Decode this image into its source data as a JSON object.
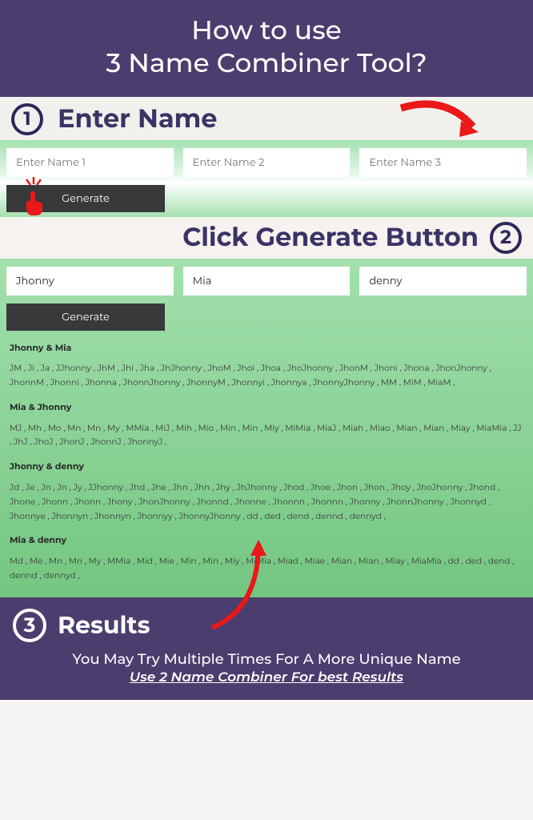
{
  "header": {
    "line1": "How to use",
    "line2": "3 Name Combiner Tool?"
  },
  "step1": {
    "num": "1",
    "label": "Enter Name"
  },
  "inputs_empty": {
    "placeholder1": "Enter Name 1",
    "placeholder2": "Enter Name 2",
    "placeholder3": "Enter Name 3"
  },
  "generate_label": "Generate",
  "step2": {
    "num": "2",
    "label": "Click Generate Button"
  },
  "inputs_filled": {
    "name1": "Jhonny",
    "name2": "Mia",
    "name3": "denny"
  },
  "results": {
    "block1": {
      "title": "Jhonny & Mia",
      "text": "JM , Ji , Ja , JJhonny , JhM , Jhi , Jha , JhJhonny , JhoM , Jhoi , Jhoa , JhoJhonny , JhonM , Jhoni , Jhona , JhonJhonny , JhonnM , Jhonni , Jhonna , JhonnJhonny , JhonnyM , Jhonnyi , Jhonnya , JhonnyJhonny , MM , MiM , MiaM ,"
    },
    "block2": {
      "title": "Mia & Jhonny",
      "text": "MJ , Mh , Mo , Mn , Mn , My , MMia , MiJ , Mih , Mio , Min , Min , Miy , MiMia , MiaJ , Miah , Miao , Mian , Mian , Miay , MiaMia , JJ , JhJ , JhoJ , JhonJ , JhonnJ , JhonnyJ ,"
    },
    "block3": {
      "title": "Jhonny & denny",
      "text": "Jd , Je , Jn , Jn , Jy , JJhonny , Jhd , Jhe , Jhn , Jhn , Jhy , JhJhonny , Jhod , Jhoe , Jhon , Jhon , Jhoy , JhoJhonny , Jhond , Jhone , Jhonn , Jhonn , Jhony , JhonJhonny , Jhonnd , Jhonne , Jhonnn , Jhonnn , Jhonny , JhonnJhonny , Jhonnyd , Jhonnye , Jhonnyn , Jhonnyn , Jhonnyy , JhonnyJhonny , dd , ded , dend , dennd , dennyd ,"
    },
    "block4": {
      "title": "Mia & denny",
      "text": "Md , Me , Mn , Mn , My , MMia , Mid , Mie , Min , Min , Miy , MiMia , Miad , Miae , Mian , Mian , Miay , MiaMia , dd , ded , dend , dennd , dennyd ,"
    }
  },
  "step3": {
    "num": "3",
    "label": "Results"
  },
  "footer": {
    "text": "You May Try Multiple Times For A More Unique Name",
    "link": "Use 2 Name Combiner For best Results"
  }
}
